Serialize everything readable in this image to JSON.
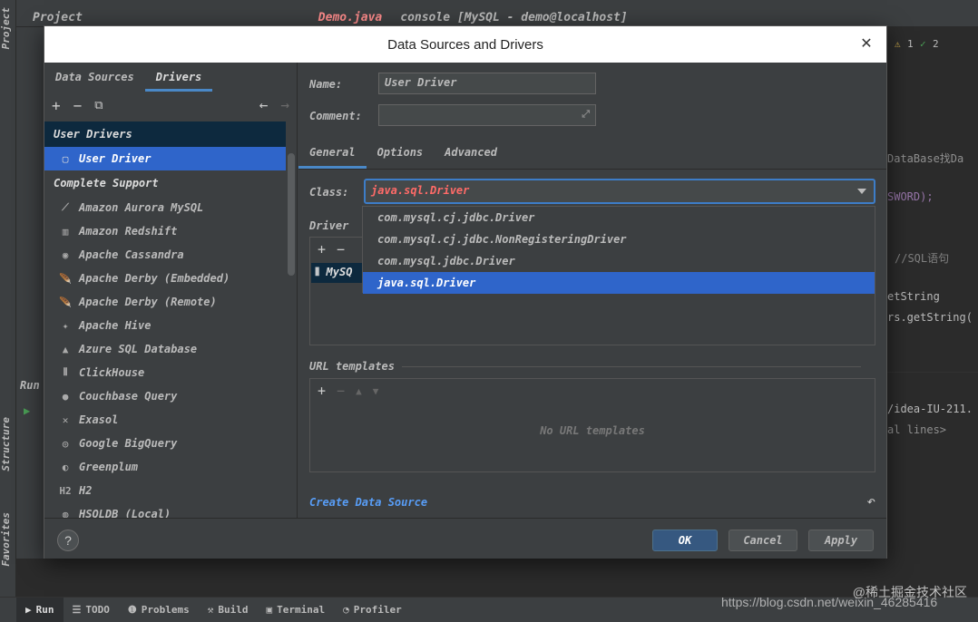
{
  "ide": {
    "tabs": [
      "Project",
      "Demo.java",
      "console [MySQL - demo@localhost]"
    ],
    "side_labels": {
      "project": "Project",
      "run": "Run",
      "structure": "Structure",
      "favorites": "Favorites"
    },
    "editor_snippets": [
      "DataBase找Da",
      "SWORD);",
      "//SQL语句",
      "etString",
      "rs.getString(",
      "/idea-IU-211.",
      "al lines>"
    ],
    "inspections": {
      "warnings": "1",
      "ok": "2"
    },
    "statusbar": [
      {
        "label": "Run",
        "icon": "play-icon"
      },
      {
        "label": "TODO",
        "icon": "list-icon"
      },
      {
        "label": "Problems",
        "icon": "info-icon"
      },
      {
        "label": "Build",
        "icon": "hammer-icon"
      },
      {
        "label": "Terminal",
        "icon": "terminal-icon"
      },
      {
        "label": "Profiler",
        "icon": "profiler-icon"
      }
    ],
    "watermark": "@稀土掘金技术社区",
    "watermark_url": "https://blog.csdn.net/weixin_46285416"
  },
  "dialog": {
    "title": "Data Sources and Drivers",
    "left": {
      "tabs": [
        "Data Sources",
        "Drivers"
      ],
      "user_drivers_header": "User Drivers",
      "user_driver": "User Driver",
      "complete_support_header": "Complete Support",
      "drivers": [
        {
          "label": "Amazon Aurora MySQL",
          "icon": "aurora-icon",
          "glyph": "⟋"
        },
        {
          "label": "Amazon Redshift",
          "icon": "redshift-icon",
          "glyph": "▥"
        },
        {
          "label": "Apache Cassandra",
          "icon": "cassandra-icon",
          "glyph": "◉"
        },
        {
          "label": "Apache Derby (Embedded)",
          "icon": "derby-icon",
          "glyph": "🪶"
        },
        {
          "label": "Apache Derby (Remote)",
          "icon": "derby-icon",
          "glyph": "🪶"
        },
        {
          "label": "Apache Hive",
          "icon": "hive-icon",
          "glyph": "✦"
        },
        {
          "label": "Azure SQL Database",
          "icon": "azure-icon",
          "glyph": "▲"
        },
        {
          "label": "ClickHouse",
          "icon": "clickhouse-icon",
          "glyph": "⦀"
        },
        {
          "label": "Couchbase Query",
          "icon": "couchbase-icon",
          "glyph": "●"
        },
        {
          "label": "Exasol",
          "icon": "exasol-icon",
          "glyph": "✕"
        },
        {
          "label": "Google BigQuery",
          "icon": "bigquery-icon",
          "glyph": "◎"
        },
        {
          "label": "Greenplum",
          "icon": "greenplum-icon",
          "glyph": "◐"
        },
        {
          "label": "H2",
          "icon": "h2-icon",
          "glyph": "H2"
        },
        {
          "label": "HSQLDB (Local)",
          "icon": "hsqldb-icon",
          "glyph": "◍"
        }
      ]
    },
    "right": {
      "name_label": "Name:",
      "name_value": "User Driver",
      "comment_label": "Comment:",
      "comment_value": "",
      "tabs": [
        "General",
        "Options",
        "Advanced"
      ],
      "class_label": "Class:",
      "class_value": "java.sql.Driver",
      "class_options": [
        "com.mysql.cj.jdbc.Driver",
        "com.mysql.cj.jdbc.NonRegisteringDriver",
        "com.mysql.jdbc.Driver",
        "java.sql.Driver"
      ],
      "driver_files_label": "Driver",
      "driver_file": "MySQ",
      "url_templates_label": "URL templates",
      "url_templates_empty": "No URL templates",
      "create_link": "Create Data Source"
    },
    "buttons": {
      "ok": "OK",
      "cancel": "Cancel",
      "apply": "Apply",
      "help": "?"
    }
  }
}
